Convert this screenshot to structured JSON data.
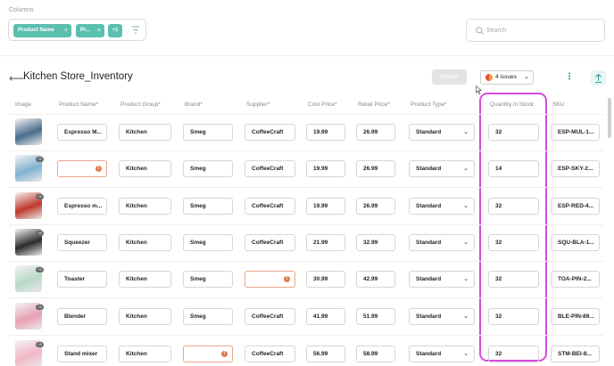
{
  "filters": {
    "columns_label": "Columns",
    "chips": [
      "Product Name",
      "Pr..."
    ],
    "more_label": "+1",
    "search_placeholder": "Search"
  },
  "header": {
    "back_icon": "arrow-left-icon",
    "title": "Kitchen Store_Inventory",
    "import_label": "Import",
    "issues_label": "4 issues"
  },
  "columns": [
    "Image",
    "Product Name*",
    "Product Group*",
    "Brand*",
    "Supplier*",
    "Cost Price*",
    "Retail Price*",
    "Product Type*",
    "Quantity in Stock",
    "SKU"
  ],
  "rows": [
    {
      "badge": "",
      "name": "Espresso M...",
      "group": "Kitchen",
      "brand": "Smeg",
      "supplier": "CoffeeCraft",
      "cost": "19.99",
      "retail": "26.99",
      "type": "Standard",
      "qty": "32",
      "sku": "ESP-MUL-1...",
      "img_color": "#4a6d8c"
    },
    {
      "badge": "+3",
      "name": "",
      "group": "Kitchen",
      "brand": "Smeg",
      "supplier": "CoffeeCraft",
      "cost": "19.99",
      "retail": "26.99",
      "type": "Standard",
      "qty": "14",
      "sku": "ESP-SKY-2...",
      "img_color": "#7fb3d1"
    },
    {
      "badge": "+3",
      "name": "Espresso m...",
      "group": "Kitchen",
      "brand": "Smeg",
      "supplier": "CoffeeCraft",
      "cost": "19.99",
      "retail": "26.99",
      "type": "Standard",
      "qty": "32",
      "sku": "ESP-RED-4...",
      "img_color": "#c0392b"
    },
    {
      "badge": "+3",
      "name": "Squeezer",
      "group": "Kitchen",
      "brand": "Smeg",
      "supplier": "CoffeeCraft",
      "cost": "21.99",
      "retail": "32.99",
      "type": "Standard",
      "qty": "32",
      "sku": "SQU-BLA-1...",
      "img_color": "#2b2b2b"
    },
    {
      "badge": "+3",
      "name": "Toaster",
      "group": "Kitchen",
      "brand": "Smeg",
      "supplier": "",
      "cost": "30.99",
      "retail": "42.99",
      "type": "Standard",
      "qty": "32",
      "sku": "TOA-PIN-2...",
      "img_color": "#b9d8c8"
    },
    {
      "badge": "+3",
      "name": "Blender",
      "group": "Kitchen",
      "brand": "Smeg",
      "supplier": "CoffeeCraft",
      "cost": "41.99",
      "retail": "51.99",
      "type": "Standard",
      "qty": "32",
      "sku": "BLE-PIN-89...",
      "img_color": "#e8a0b4"
    },
    {
      "badge": "+3",
      "name": "Stand mixer",
      "group": "Kitchen",
      "brand": "",
      "supplier": "CoffeeCraft",
      "cost": "56.99",
      "retail": "58.99",
      "type": "Standard",
      "qty": "32",
      "sku": "STM-BEI-8...",
      "img_color": "#f2b7c6"
    }
  ]
}
